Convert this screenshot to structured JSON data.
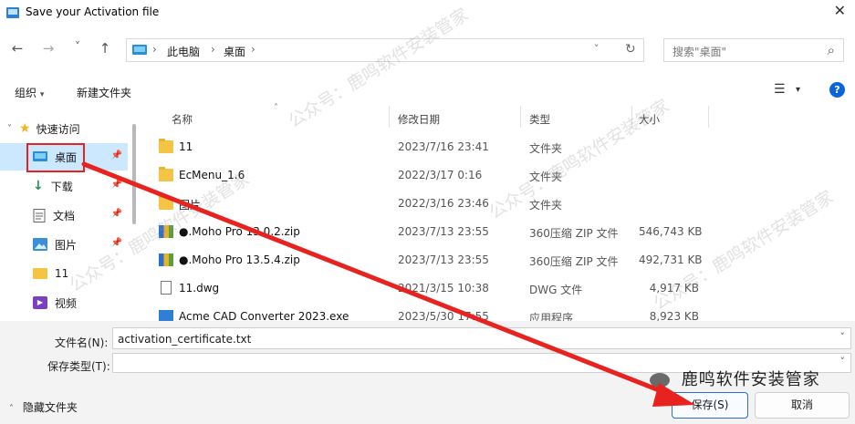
{
  "window": {
    "title": "Save your Activation file",
    "close_glyph": "✕"
  },
  "nav": {
    "back": "←",
    "forward": "→",
    "recent": "˅",
    "up": "↑",
    "refresh": "↻",
    "dropdown": "˅"
  },
  "breadcrumb": {
    "sep": "›",
    "items": [
      "此电脑",
      "桌面"
    ]
  },
  "search": {
    "placeholder": "搜索\"桌面\"",
    "icon": "⌕"
  },
  "commandbar": {
    "organize": "组织",
    "organize_caret": "▾",
    "new_folder": "新建文件夹",
    "view_icon": "☰",
    "view_caret": "▾",
    "help": "?"
  },
  "sidebar": {
    "items": [
      {
        "label": "快速访问",
        "icon": "star-icon",
        "expand": "˅"
      },
      {
        "label": "桌面",
        "icon": "desktop-icon",
        "pinned": true
      },
      {
        "label": "下载",
        "icon": "download-icon",
        "pinned": true
      },
      {
        "label": "文档",
        "icon": "document-icon",
        "pinned": true
      },
      {
        "label": "图片",
        "icon": "picture-icon",
        "pinned": true
      },
      {
        "label": "11",
        "icon": "folder-icon"
      },
      {
        "label": "视频",
        "icon": "video-icon"
      }
    ]
  },
  "columns": {
    "name": "名称",
    "date": "修改日期",
    "type": "类型",
    "size": "大小"
  },
  "files": [
    {
      "name": "11",
      "date": "2023/7/16 23:41",
      "type": "文件夹",
      "size": "",
      "kind": "folder"
    },
    {
      "name": "EcMenu_1.6",
      "date": "2022/3/17 0:16",
      "type": "文件夹",
      "size": "",
      "kind": "folder"
    },
    {
      "name": "图片",
      "date": "2022/3/16 23:46",
      "type": "文件夹",
      "size": "",
      "kind": "folder"
    },
    {
      "name": "●.Moho Pro 13.0.2.zip",
      "date": "2023/7/13 23:55",
      "type": "360压缩 ZIP 文件",
      "size": "546,743 KB",
      "kind": "zip"
    },
    {
      "name": "●.Moho Pro 13.5.4.zip",
      "date": "2023/7/13 23:55",
      "type": "360压缩 ZIP 文件",
      "size": "492,731 KB",
      "kind": "zip"
    },
    {
      "name": "11.dwg",
      "date": "2021/3/15 10:38",
      "type": "DWG 文件",
      "size": "4,917 KB",
      "kind": "doc"
    },
    {
      "name": "Acme CAD Converter 2023.exe",
      "date": "2023/5/30 17:55",
      "type": "应用程序",
      "size": "8,923 KB",
      "kind": "exe"
    }
  ],
  "form": {
    "filename_label": "文件名(N):",
    "filename_value": "activation_certificate.txt",
    "filetype_label": "保存类型(T):",
    "filetype_value": "",
    "caret": "˅"
  },
  "footer": {
    "hide_folders": "隐藏文件夹",
    "hide_caret": "˄",
    "save": "保存(S)",
    "cancel": "取消"
  },
  "watermark": {
    "brand": "鹿鸣软件安装管家",
    "soft": "公众号：鹿鸣软件安装管家"
  },
  "colors": {
    "annotation_red": "#e8231f",
    "selection": "#cce8ff",
    "help_blue": "#0a66d8"
  }
}
